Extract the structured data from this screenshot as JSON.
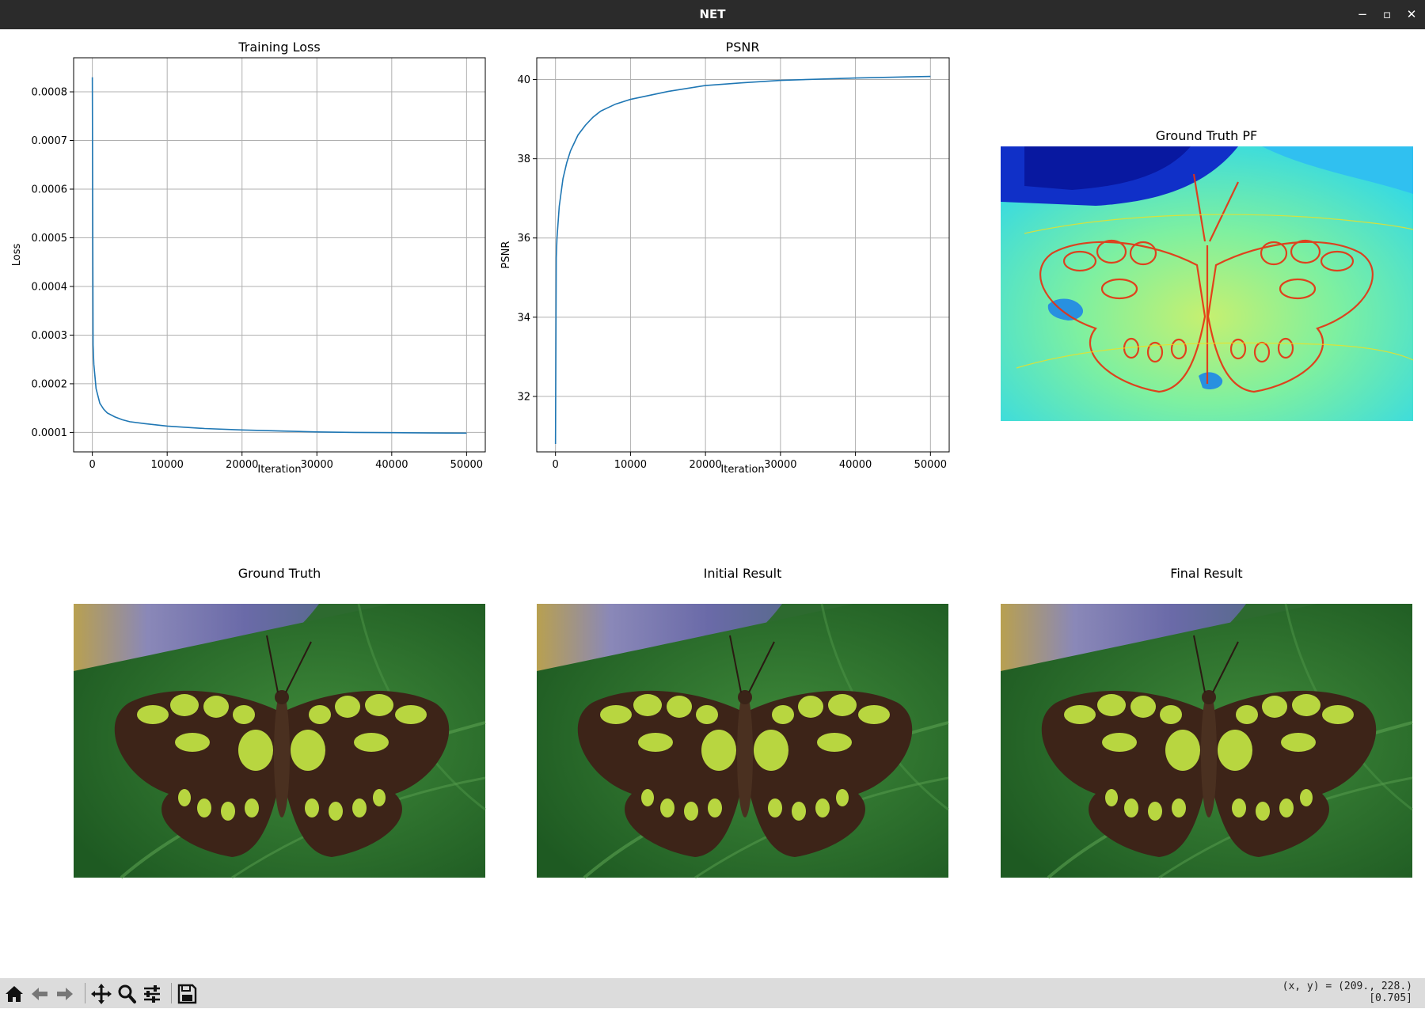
{
  "window": {
    "title": "NET"
  },
  "window_controls": {
    "minimize": "−",
    "maximize": "▫",
    "close": "✕"
  },
  "panels": {
    "gt_pf": {
      "title": "Ground Truth PF"
    },
    "ground_truth": {
      "title": "Ground Truth"
    },
    "initial": {
      "title": "Initial Result"
    },
    "final": {
      "title": "Final Result"
    }
  },
  "chart_data": [
    {
      "type": "line",
      "title": "Training Loss",
      "xlabel": "Iteration",
      "ylabel": "Loss",
      "xlim": [
        -2500,
        52500
      ],
      "ylim": [
        6e-05,
        0.00087
      ],
      "xticks": [
        0,
        10000,
        20000,
        30000,
        40000,
        50000
      ],
      "xticklabels": [
        "0",
        "10000",
        "20000",
        "30000",
        "40000",
        "50000"
      ],
      "yticks": [
        0.0001,
        0.0002,
        0.0003,
        0.0004,
        0.0005,
        0.0006,
        0.0007,
        0.0008
      ],
      "yticklabels": [
        "0.0001",
        "0.0002",
        "0.0003",
        "0.0004",
        "0.0005",
        "0.0006",
        "0.0007",
        "0.0008"
      ],
      "grid": true,
      "color": "#1f77b4",
      "x": [
        0,
        100,
        200,
        500,
        1000,
        1500,
        2000,
        3000,
        4000,
        5000,
        7000,
        10000,
        15000,
        20000,
        25000,
        30000,
        35000,
        40000,
        45000,
        50000
      ],
      "y": [
        0.00083,
        0.00028,
        0.00024,
        0.00019,
        0.00016,
        0.000148,
        0.00014,
        0.000132,
        0.000126,
        0.000122,
        0.000118,
        0.000113,
        0.000108,
        0.000105,
        0.000103,
        0.000101,
        0.0001,
        9.95e-05,
        9.9e-05,
        9.85e-05
      ]
    },
    {
      "type": "line",
      "title": "PSNR",
      "xlabel": "Iteration",
      "ylabel": "PSNR",
      "xlim": [
        -2500,
        52500
      ],
      "ylim": [
        30.6,
        40.55
      ],
      "xticks": [
        0,
        10000,
        20000,
        30000,
        40000,
        50000
      ],
      "xticklabels": [
        "0",
        "10000",
        "20000",
        "30000",
        "40000",
        "50000"
      ],
      "yticks": [
        32,
        34,
        36,
        38,
        40
      ],
      "yticklabels": [
        "32",
        "34",
        "36",
        "38",
        "40"
      ],
      "grid": true,
      "color": "#1f77b4",
      "x": [
        0,
        100,
        200,
        500,
        1000,
        1500,
        2000,
        3000,
        4000,
        5000,
        6000,
        8000,
        10000,
        15000,
        20000,
        25000,
        30000,
        35000,
        40000,
        45000,
        50000
      ],
      "y": [
        30.8,
        35.5,
        36.0,
        36.8,
        37.5,
        37.9,
        38.2,
        38.6,
        38.85,
        39.05,
        39.2,
        39.38,
        39.5,
        39.7,
        39.85,
        39.92,
        39.98,
        40.01,
        40.04,
        40.06,
        40.08
      ]
    }
  ],
  "toolbar": {
    "buttons": [
      {
        "id": "home",
        "icon": "home-icon"
      },
      {
        "id": "back",
        "icon": "arrow-left-icon"
      },
      {
        "id": "forward",
        "icon": "arrow-right-icon"
      },
      {
        "id": "pan",
        "icon": "move-icon"
      },
      {
        "id": "zoom",
        "icon": "magnifier-icon"
      },
      {
        "id": "configure",
        "icon": "sliders-icon"
      },
      {
        "id": "save",
        "icon": "floppy-icon"
      }
    ],
    "coords_line1": "(x, y) = (209., 228.)",
    "coords_line2": "[0.705]"
  }
}
